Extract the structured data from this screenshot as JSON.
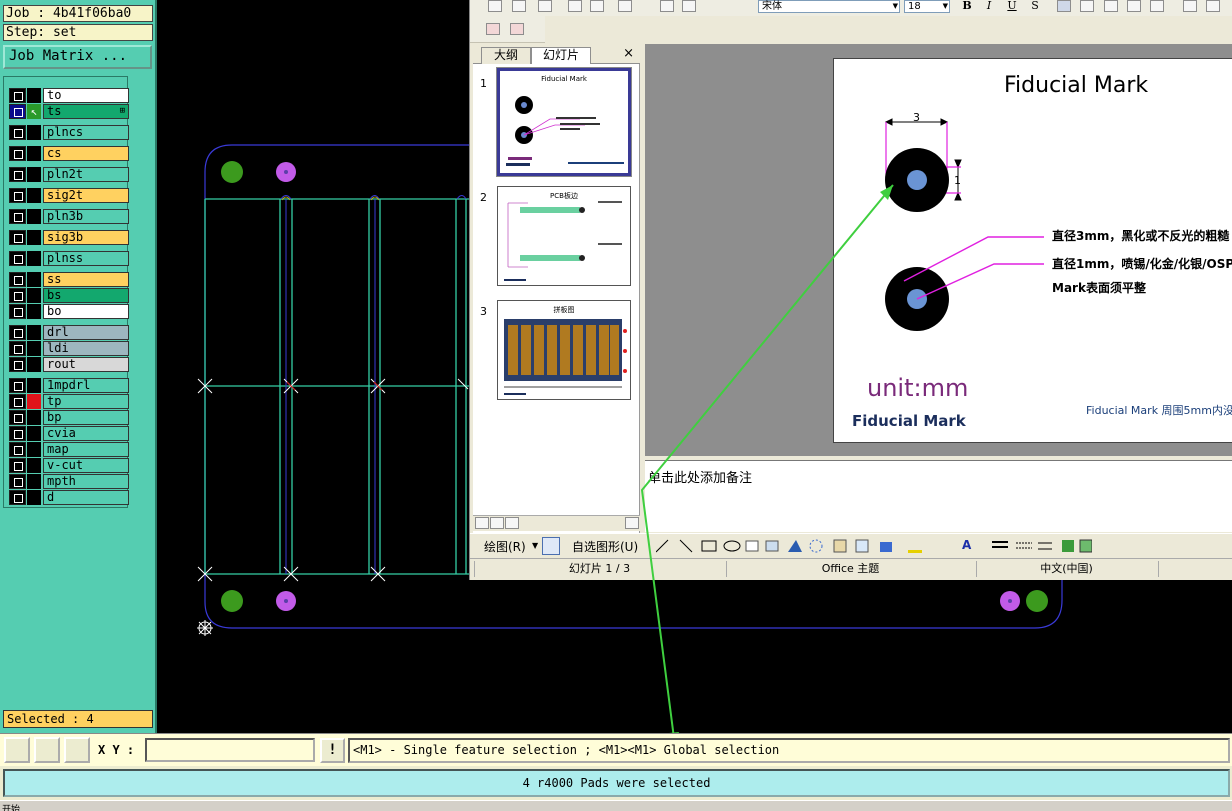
{
  "left_panel": {
    "job_label": "Job : 4b41f06ba0",
    "step_label": "Step: set",
    "job_matrix_button": "Job Matrix ...",
    "selected_label": "Selected : 4",
    "layers": [
      {
        "name": "to",
        "color": "#FFFFFF"
      },
      {
        "name": "ts",
        "color": "#13A86E",
        "active": true,
        "extra": "⊞"
      },
      {
        "name": "plncs",
        "color": "#55CDB1"
      },
      {
        "name": "cs",
        "color": "#FFD160"
      },
      {
        "name": "pln2t",
        "color": "#55CDB1"
      },
      {
        "name": "sig2t",
        "color": "#FFD160"
      },
      {
        "name": "pln3b",
        "color": "#55CDB1"
      },
      {
        "name": "sig3b",
        "color": "#FFD160"
      },
      {
        "name": "plnss",
        "color": "#55CDB1"
      },
      {
        "name": "ss",
        "color": "#FFD160"
      },
      {
        "name": "bs",
        "color": "#13A86E"
      },
      {
        "name": "bo",
        "color": "#FFFFFF"
      },
      {
        "name": "drl",
        "color": "#9DB6BF"
      },
      {
        "name": "ldi",
        "color": "#9DB6BF"
      },
      {
        "name": "rout",
        "color": "#D8D8D8"
      },
      {
        "name": "1mpdrl",
        "color": "#55CDB1"
      },
      {
        "name": "tp",
        "color": "#55CDB1",
        "mark": "red"
      },
      {
        "name": "bp",
        "color": "#55CDB1"
      },
      {
        "name": "cvia",
        "color": "#55CDB1"
      },
      {
        "name": "map",
        "color": "#55CDB1"
      },
      {
        "name": "v-cut",
        "color": "#55CDB1"
      },
      {
        "name": "mpth",
        "color": "#55CDB1"
      },
      {
        "name": "d",
        "color": "#55CDB1"
      }
    ]
  },
  "ppt": {
    "font_name": "宋体",
    "font_size": "18",
    "format_buttons": [
      "B",
      "I",
      "U",
      "S"
    ],
    "tabs": [
      "大纲",
      "幻灯片"
    ],
    "close_glyph": "×",
    "thumb_numbers": [
      "1",
      "2",
      "3"
    ],
    "thumb_titles": [
      "Fiducial Mark",
      "PCB板边",
      "拼板图"
    ],
    "slide": {
      "title": "Fiducial Mark",
      "dim_top": "3",
      "dim_side": "1",
      "desc1": "直径3mm，黑化或不反光的粗糙",
      "desc2": "直径1mm，喷锡/化金/化银/OSP",
      "desc3": "Mark表面须平整",
      "unit": "unit:mm",
      "subtitle": "Fiducial Mark",
      "footnote": "Fiducial Mark 周围5mm内没"
    },
    "notes_placeholder": "单击此处添加备注",
    "draw_label": "绘图(R)",
    "autoshape_label": "自选图形(U)",
    "status": {
      "slide_counter": "幻灯片 1 / 3",
      "theme": "Office 主题",
      "language": "中文(中国)"
    }
  },
  "bottom": {
    "xy_label": "X Y :",
    "xy_value": "",
    "warn_glyph": "!",
    "hint": "<M1> - Single feature selection ; <M1><M1> Global selection",
    "message": "4 r4000 Pads were selected",
    "start_label": "开始"
  },
  "colors": {
    "panel_bg": "#55CDB1",
    "outline_teal": "#35CEA5",
    "pad_green": "#3C9A1E",
    "pad_violet": "#C25BE8",
    "arrow_green": "#3FCF3F"
  }
}
